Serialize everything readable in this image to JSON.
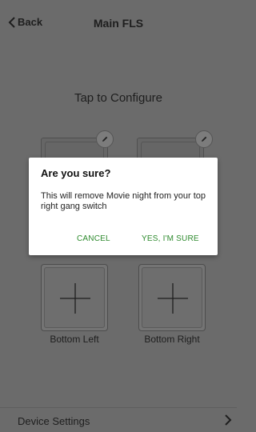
{
  "header": {
    "back_label": "Back",
    "title": "Main FLS"
  },
  "main": {
    "tap_text": "Tap to Configure",
    "bottom_left_label": "Bottom Left",
    "bottom_right_label": "Bottom Right"
  },
  "footer": {
    "device_settings_label": "Device Settings"
  },
  "dialog": {
    "title": "Are you sure?",
    "message": "This will remove Movie night from your top right gang switch",
    "cancel_label": "CANCEL",
    "confirm_label": "YES, I'M SURE"
  },
  "colors": {
    "accent": "#2e8b2e",
    "background": "#6b6b6b",
    "dialog_bg": "#ffffff"
  },
  "icons": [
    "chevron-left-icon",
    "pencil-icon",
    "plus-icon",
    "chevron-right-icon"
  ]
}
